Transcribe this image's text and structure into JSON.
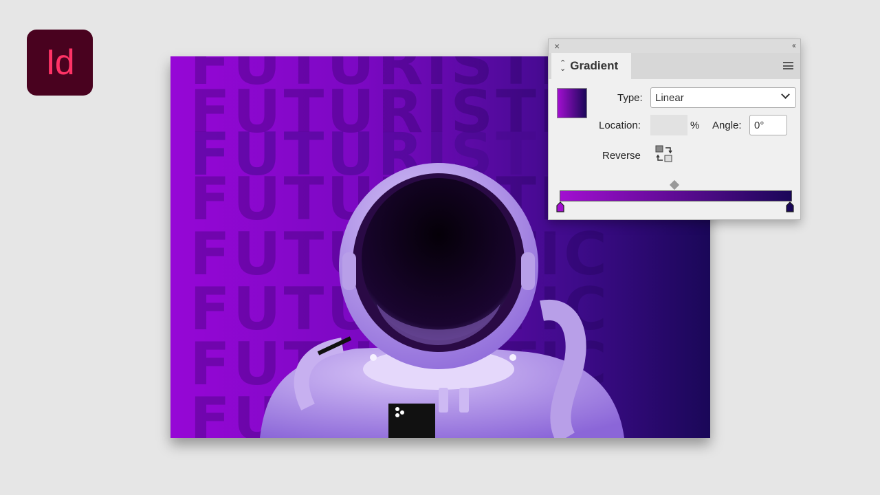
{
  "app": {
    "logo_text": "Id",
    "logo_bg": "#49021f",
    "logo_fg": "#ff3366"
  },
  "artwork": {
    "word": "FUTURISTIC",
    "gradient_start": "#9607d6",
    "gradient_end": "#1a0758"
  },
  "panel": {
    "tab_label": "Gradient",
    "close_icon": "close-icon",
    "collapse_icon": "double-chevron-left-icon",
    "menu_icon": "hamburger-menu-icon",
    "type_label": "Type:",
    "type_value": "Linear",
    "location_label": "Location:",
    "location_value": "",
    "percent_sign": "%",
    "angle_label": "Angle:",
    "angle_value": "0°",
    "reverse_label": "Reverse",
    "ramp_start_color": "#a20fd0",
    "ramp_end_color": "#1a0758"
  }
}
